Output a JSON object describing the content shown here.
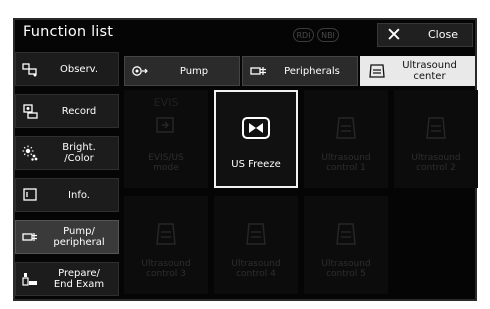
{
  "header": {
    "title": "Function list",
    "indicators": [
      "RDI",
      "NBI"
    ],
    "close_label": "Close"
  },
  "sidebar": {
    "items": [
      {
        "label": "Observ.",
        "icon": "observation-icon"
      },
      {
        "label": "Record",
        "icon": "record-icon"
      },
      {
        "label": "Bright.\n/Color",
        "icon": "brightness-icon"
      },
      {
        "label": "Info.",
        "icon": "info-icon"
      },
      {
        "label": "Pump/\nperipheral",
        "icon": "peripheral-icon",
        "active": true
      },
      {
        "label": "Prepare/\nEnd Exam",
        "icon": "prepare-icon"
      }
    ]
  },
  "tabs": [
    {
      "label": "Pump",
      "icon": "pump-icon"
    },
    {
      "label": "Peripherals",
      "icon": "peripherals-icon"
    },
    {
      "label": "Ultrasound\ncenter",
      "icon": "ultrasound-icon",
      "active": true
    }
  ],
  "tiles": [
    {
      "label": "EVIS/US\nmode",
      "top": "EVIS",
      "icon": "evis-us-icon",
      "state": "disabled"
    },
    {
      "label": "US Freeze",
      "icon": "freeze-icon",
      "state": "selected"
    },
    {
      "label": "Ultrasound\ncontrol 1",
      "icon": "ultrasound-icon",
      "state": "disabled"
    },
    {
      "label": "Ultrasound\ncontrol 2",
      "icon": "ultrasound-icon",
      "state": "disabled"
    },
    {
      "label": "Ultrasound\ncontrol 3",
      "icon": "ultrasound-icon",
      "state": "disabled"
    },
    {
      "label": "Ultrasound\ncontrol 4",
      "icon": "ultrasound-icon",
      "state": "disabled"
    },
    {
      "label": "Ultrasound\ncontrol 5",
      "icon": "ultrasound-icon",
      "state": "disabled"
    }
  ],
  "colors": {
    "background": "#050505",
    "selected_tab": "#e9e9e9",
    "disabled_text": "#2e2e2e",
    "active_sidebar": "#3a3a3a"
  }
}
